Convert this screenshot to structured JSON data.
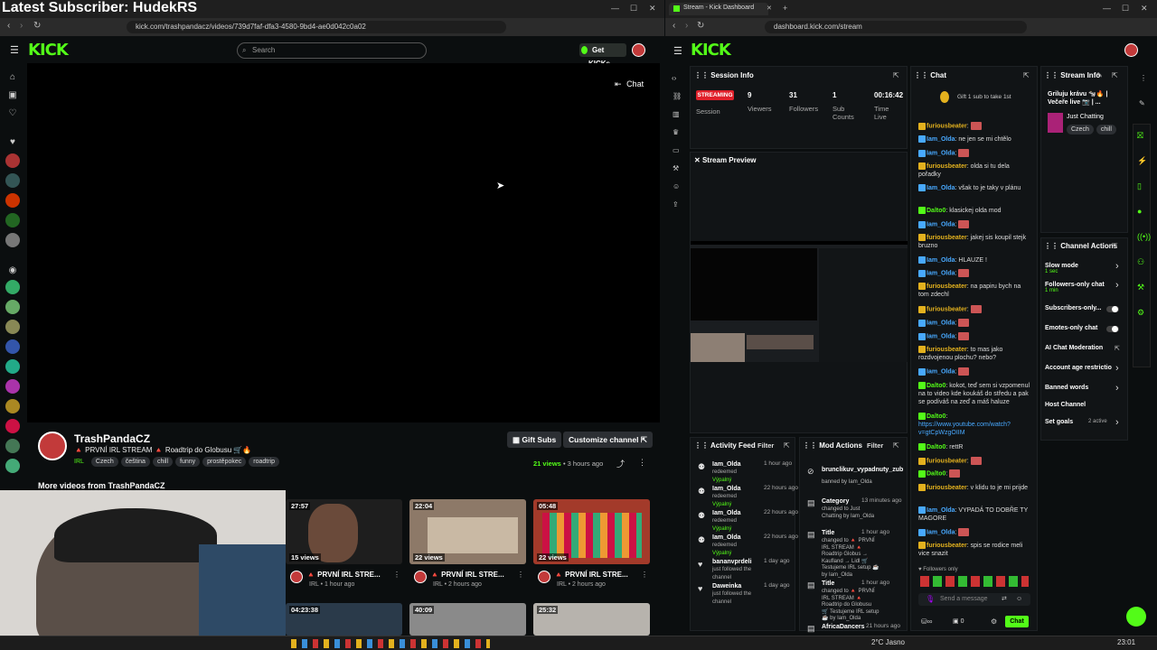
{
  "overlay": {
    "title": "Latest Subscriber: HudekRS"
  },
  "left_browser": {
    "url": "kick.com/trashpandacz/videos/739d7faf-dfa3-4580-9bd4-ae0d042c0a02",
    "search_placeholder": "Search",
    "get_kicks": "Get KICKs",
    "chat_toggle": "Chat",
    "logo": "KICK"
  },
  "channel": {
    "name": "TrashPandaCZ",
    "title": "🔺 PRVNÍ IRL STREAM 🔺 Roadtrip do Globusu 🛒🔥",
    "tags": [
      "IRL",
      "Czech",
      "čeština",
      "chill",
      "funny",
      "prostěpokec",
      "roadtrip"
    ],
    "gift_subs": "Gift Subs",
    "customize": "Customize channel",
    "views": "21 views",
    "ago": "3 hours ago",
    "more_videos": "More videos from TrashPandaCZ"
  },
  "videos": [
    {
      "duration": "27:57",
      "views": "15 views",
      "title": "🔺 PRVNÍ IRL STRE...",
      "sub": "IRL • 1 hour ago"
    },
    {
      "duration": "22:04",
      "views": "22 views",
      "title": "🔺 PRVNÍ IRL STRE...",
      "sub": "IRL • 2 hours ago"
    },
    {
      "duration": "05:48",
      "views": "22 views",
      "title": "🔺 PRVNÍ IRL STRE...",
      "sub": "IRL • 2 hours ago"
    },
    {
      "duration": "04:23:38"
    },
    {
      "duration": "40:09"
    },
    {
      "duration": "25:32"
    }
  ],
  "right_browser": {
    "tab_title": "Stream - Kick Dashboard",
    "url": "dashboard.kick.com/stream",
    "logo": "KICK"
  },
  "session": {
    "title": "Session Info",
    "status": "STREAMING",
    "session_label": "Session",
    "viewers": "9",
    "viewers_label": "Viewers",
    "followers": "31",
    "followers_label": "Followers",
    "subs": "1",
    "subs_label": "Sub Counts",
    "time": "00:16:42",
    "time_label": "Time Live"
  },
  "preview": {
    "title": "Stream Preview"
  },
  "chat": {
    "title": "Chat",
    "gift_banner": "Gift 1 sub to take 1st",
    "followers_only": "Followers only",
    "input_placeholder": "Send a message",
    "send": "Chat",
    "points": "0",
    "lines": [
      {
        "user": "furiousbeater",
        "cls": "u-gold",
        "text": ""
      },
      {
        "user": "Iam_Olda",
        "cls": "u-blue",
        "text": "ne jen se mi chtělo"
      },
      {
        "user": "Iam_Olda",
        "cls": "u-blue",
        "text": ""
      },
      {
        "user": "furiousbeater",
        "cls": "u-gold",
        "text": "olda si tu dela pořadky"
      },
      {
        "user": "Iam_Olda",
        "cls": "u-blue",
        "text": "však to je taky v plánu"
      },
      {
        "user": "Dalto0",
        "cls": "u-green",
        "text": "klasickej olda mod"
      },
      {
        "user": "Iam_Olda",
        "cls": "u-blue",
        "text": ""
      },
      {
        "user": "furiousbeater",
        "cls": "u-gold",
        "text": "jakej sis koupil stejk bruzno"
      },
      {
        "user": "Iam_Olda",
        "cls": "u-blue",
        "text": "HLAUZE !"
      },
      {
        "user": "Iam_Olda",
        "cls": "u-blue",
        "text": ""
      },
      {
        "user": "furiousbeater",
        "cls": "u-gold",
        "text": "na papiru bych na tom zdechl"
      },
      {
        "user": "furiousbeater",
        "cls": "u-gold",
        "text": ""
      },
      {
        "user": "Iam_Olda",
        "cls": "u-blue",
        "text": ""
      },
      {
        "user": "Iam_Olda",
        "cls": "u-blue",
        "text": ""
      },
      {
        "user": "furiousbeater",
        "cls": "u-gold",
        "text": "to mas jako rozdvojenou plochu? nebo?"
      },
      {
        "user": "Iam_Olda",
        "cls": "u-blue",
        "text": ""
      },
      {
        "user": "Dalto0",
        "cls": "u-green",
        "text": "kokot, teď sem si vzpomenul na to video kde koukáš do středu a pak se podíváš na zeď a máš haluze"
      },
      {
        "user": "Dalto0",
        "cls": "u-green",
        "text": "https://www.youtube.com/watch?v=gtCpWzgOIIM"
      },
      {
        "user": "Dalto0",
        "cls": "u-green",
        "text": "rettR"
      },
      {
        "user": "furiousbeater",
        "cls": "u-gold",
        "text": ""
      },
      {
        "user": "Dalto0",
        "cls": "u-green",
        "text": ""
      },
      {
        "user": "furiousbeater",
        "cls": "u-gold",
        "text": "v klidu to je mi prijde"
      },
      {
        "user": "Iam_Olda",
        "cls": "u-blue",
        "text": "VYPADÁ TO DOBŘE TY MAGORE"
      },
      {
        "user": "Iam_Olda",
        "cls": "u-blue",
        "text": ""
      },
      {
        "user": "furiousbeater",
        "cls": "u-gold",
        "text": "spis se rodice meli vice snazit"
      }
    ]
  },
  "stream_info": {
    "title": "Stream Info",
    "stream_title": "Griluju krávu 🐄🔥 | Večeře live 📷 | ...",
    "category": "Just Chatting",
    "tags": [
      "Czech",
      "chill"
    ]
  },
  "channel_actions": {
    "title": "Channel Actions",
    "items": [
      {
        "label": "Slow mode",
        "sub": "1 sec"
      },
      {
        "label": "Followers-only chat",
        "sub": "1 min"
      },
      {
        "label": "Subscribers-only...",
        "sub": ""
      },
      {
        "label": "Emotes-only chat",
        "sub": ""
      },
      {
        "label": "AI Chat Moderation",
        "sub": ""
      },
      {
        "label": "Account age restrictio",
        "sub": ""
      },
      {
        "label": "Banned words",
        "sub": ""
      },
      {
        "label": "Host Channel",
        "sub": ""
      },
      {
        "label": "Set goals",
        "sub": "2 active"
      }
    ]
  },
  "activity": {
    "title": "Activity Feed",
    "filter": "Filter",
    "items": [
      {
        "user": "Iam_Olda",
        "action": "redeemed",
        "reward": "Výpalný",
        "time": "1 hour ago"
      },
      {
        "user": "Iam_Olda",
        "action": "redeemed",
        "reward": "Výpalný",
        "time": "22 hours ago"
      },
      {
        "user": "Iam_Olda",
        "action": "redeemed",
        "reward": "Výpalný",
        "time": "22 hours ago"
      },
      {
        "user": "Iam_Olda",
        "action": "redeemed",
        "reward": "Výpalný",
        "time": "22 hours ago"
      },
      {
        "user": "bananvprdeli",
        "action": "just followed the channel",
        "reward": "",
        "time": "1 day ago"
      },
      {
        "user": "Daweinka",
        "action": "just followed the channel",
        "reward": "",
        "time": "1 day ago"
      }
    ]
  },
  "mod_actions": {
    "title": "Mod Actions",
    "filter": "Filter",
    "items": [
      {
        "head": "brunclikuv_vypadnuty_zub",
        "body": "banned by Iam_Olda",
        "time": ""
      },
      {
        "head": "Category",
        "body": "changed to Just Chatting by Iam_Olda",
        "time": "13 minutes ago"
      },
      {
        "head": "Title",
        "body": "changed to 🔺 PRVNÍ IRL STREAM 🔺 Roadtrip Globus → Kaufland → Lidl 🛒 Testujeme IRL setup ☕ by Iam_Olda",
        "time": "1 hour ago"
      },
      {
        "head": "Title",
        "body": "changed to 🔺 PRVNÍ IRL STREAM 🔺 Roadtrip do Globusu 🛒 Testujeme IRL setup ☕ by Iam_Olda",
        "time": "1 hour ago"
      },
      {
        "head": "AfricaDancers",
        "body": "",
        "time": "21 hours ago"
      }
    ]
  },
  "taskbar": {
    "weather": "2°C Jasno",
    "clock": "23:01"
  }
}
